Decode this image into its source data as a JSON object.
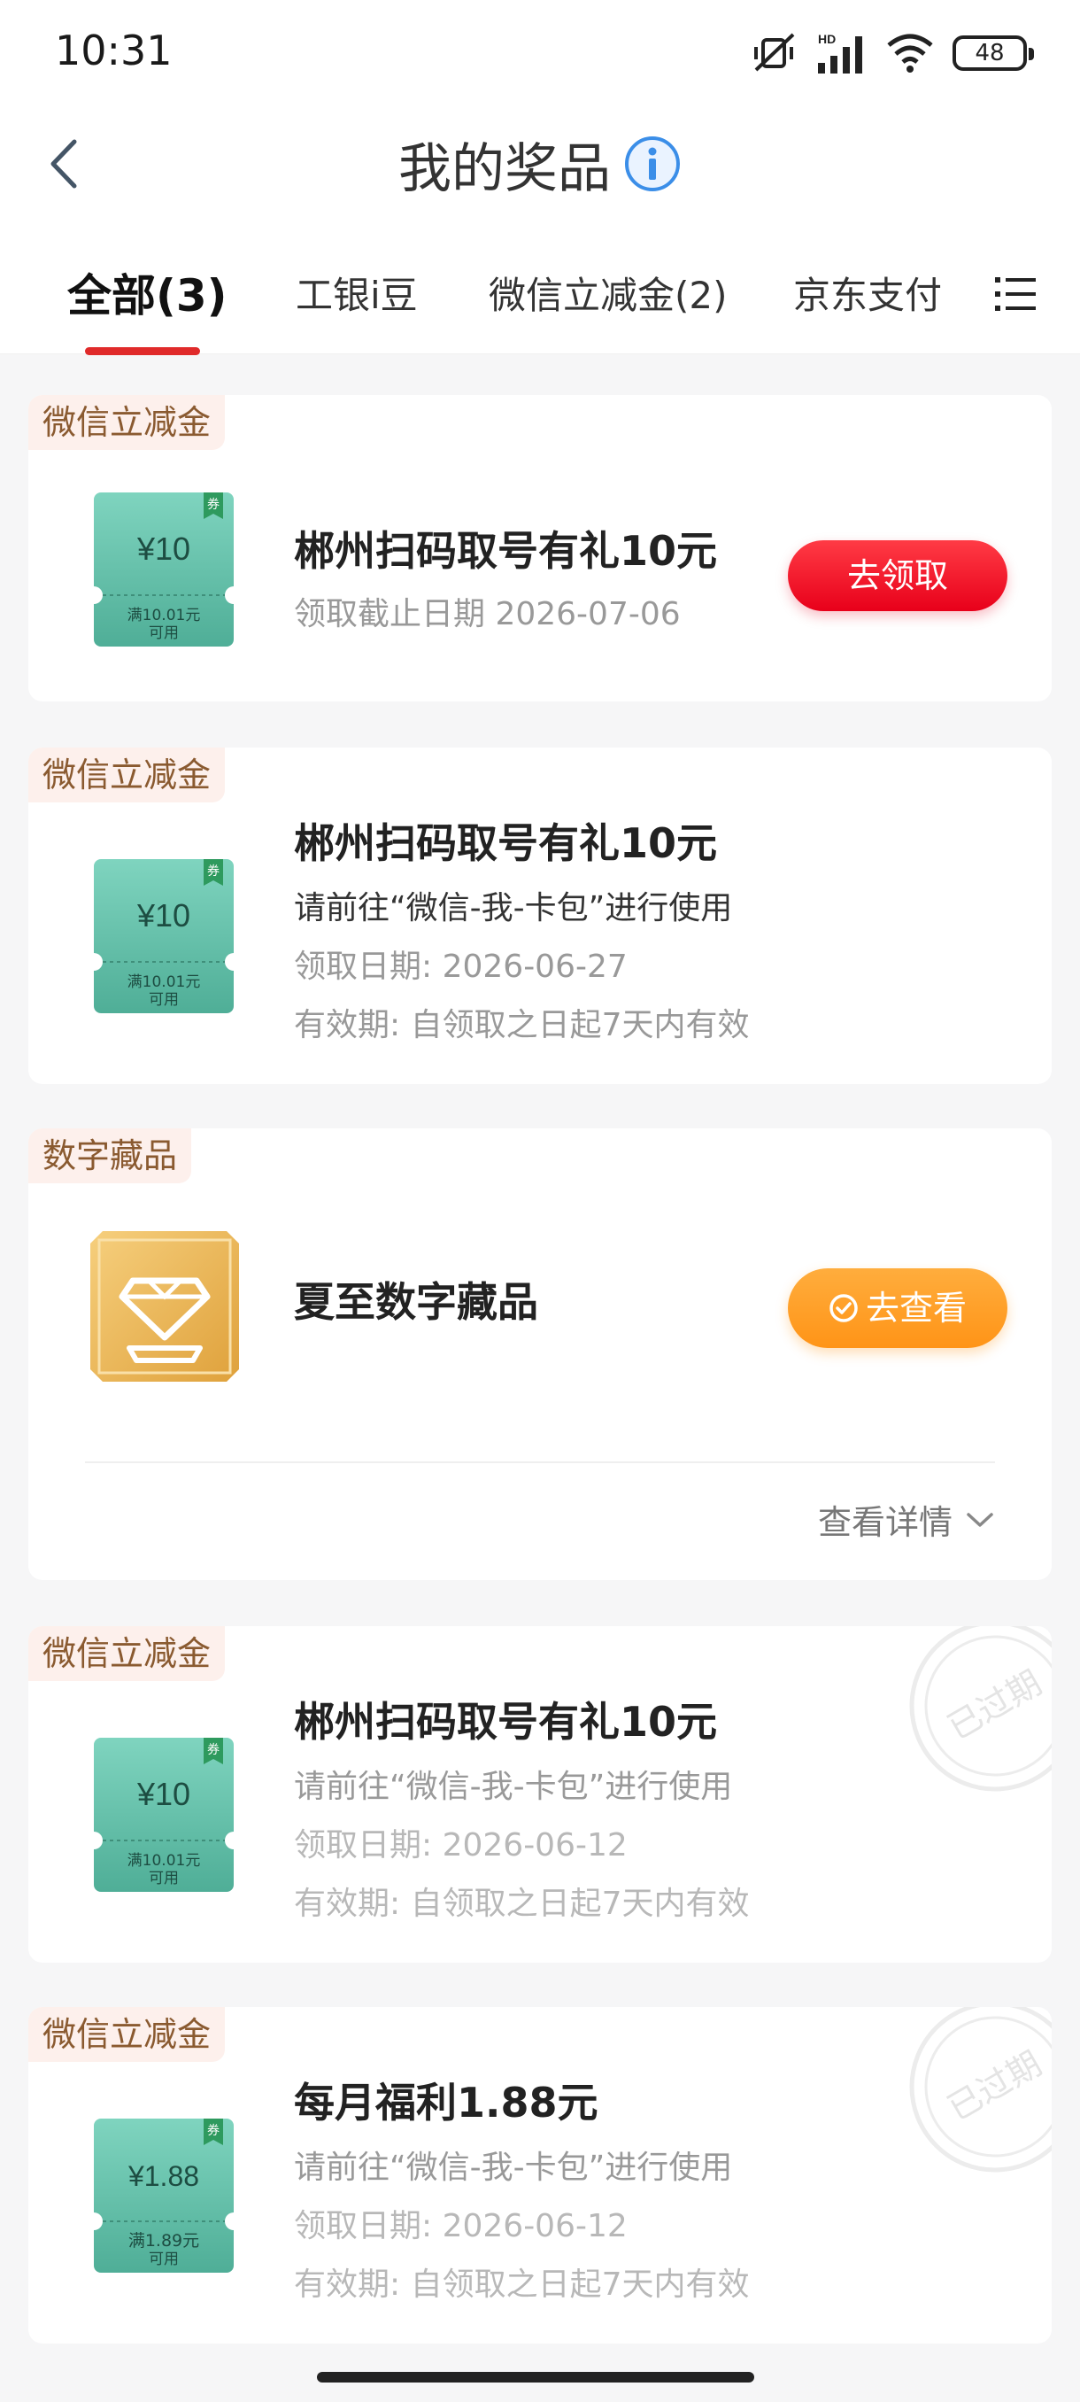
{
  "status_bar": {
    "time": "10:31",
    "battery": "48",
    "icons": [
      "mute-icon",
      "hd-signal-icon",
      "wifi-icon",
      "battery-icon"
    ]
  },
  "nav": {
    "title": "我的奖品",
    "back_icon": "chevron-left-icon",
    "info_icon": "info-icon"
  },
  "tabs": [
    {
      "label": "全部(3)",
      "active": true
    },
    {
      "label": "工银i豆",
      "active": false
    },
    {
      "label": "微信立减金(2)",
      "active": false
    },
    {
      "label": "京东支付",
      "active": false
    }
  ],
  "cards": [
    {
      "tag": "微信立减金",
      "coupon": {
        "amount": "¥10",
        "condition": "满10.01元",
        "usable": "可用",
        "badge": "券"
      },
      "title": "郴州扫码取号有礼10元",
      "lines": [
        "领取截止日期 2026-07-06"
      ],
      "button": "去领取"
    },
    {
      "tag": "微信立减金",
      "coupon": {
        "amount": "¥10",
        "condition": "满10.01元",
        "usable": "可用",
        "badge": "券"
      },
      "title": "郴州扫码取号有礼10元",
      "lines": [
        "请前往“微信-我-卡包”进行使用",
        "领取日期: 2026-06-27",
        "有效期: 自领取之日起7天内有效"
      ]
    },
    {
      "tag": "数字藏品",
      "title": "夏至数字藏品",
      "button": "去查看",
      "details_link": "查看详情"
    },
    {
      "tag": "微信立减金",
      "coupon": {
        "amount": "¥10",
        "condition": "满10.01元",
        "usable": "可用",
        "badge": "券"
      },
      "title": "郴州扫码取号有礼10元",
      "lines": [
        "请前往“微信-我-卡包”进行使用",
        "领取日期: 2026-06-12",
        "有效期: 自领取之日起7天内有效"
      ],
      "stamp": "已过期"
    },
    {
      "tag": "微信立减金",
      "coupon": {
        "amount": "¥1.88",
        "condition": "满1.89元",
        "usable": "可用",
        "badge": "券"
      },
      "title": "每月福利1.88元",
      "lines": [
        "请前往“微信-我-卡包”进行使用",
        "领取日期: 2026-06-12",
        "有效期: 自领取之日起7天内有效"
      ],
      "stamp": "已过期"
    }
  ],
  "colors": {
    "accent_red": "#e02a2a",
    "coupon_green": "#5cbfa8",
    "orange": "#ff9a20",
    "gold": "#e8b04d"
  }
}
